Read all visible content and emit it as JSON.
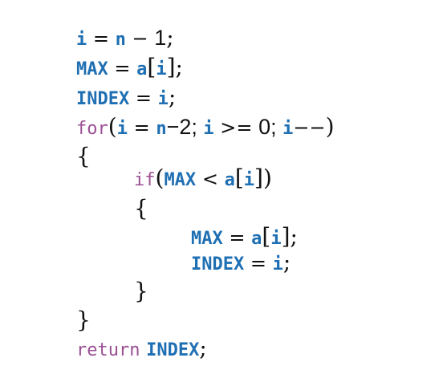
{
  "code": {
    "lines": [
      [
        {
          "text": "i",
          "type": "var"
        },
        {
          "text": " = ",
          "type": "op"
        },
        {
          "text": "n",
          "type": "var"
        },
        {
          "text": " − ",
          "type": "op"
        },
        {
          "text": "1",
          "type": "num"
        },
        {
          "text": ";",
          "type": "punct"
        }
      ],
      [
        {
          "text": "MAX",
          "type": "var"
        },
        {
          "text": " = ",
          "type": "op"
        },
        {
          "text": "a",
          "type": "var"
        },
        {
          "text": "[",
          "type": "punct"
        },
        {
          "text": "i",
          "type": "var"
        },
        {
          "text": "]",
          "type": "punct"
        },
        {
          "text": ";",
          "type": "punct"
        }
      ],
      [
        {
          "text": "INDEX",
          "type": "var"
        },
        {
          "text": " = ",
          "type": "op"
        },
        {
          "text": "i",
          "type": "var"
        },
        {
          "text": ";",
          "type": "punct"
        }
      ],
      [
        {
          "text": "for",
          "type": "kw"
        },
        {
          "text": "(",
          "type": "punct"
        },
        {
          "text": "i",
          "type": "var"
        },
        {
          "text": " = ",
          "type": "op"
        },
        {
          "text": "n",
          "type": "var"
        },
        {
          "text": "−2; ",
          "type": "num"
        },
        {
          "text": "i",
          "type": "var"
        },
        {
          "text": " >= ",
          "type": "op"
        },
        {
          "text": "0; ",
          "type": "num"
        },
        {
          "text": "i",
          "type": "var"
        },
        {
          "text": "−−",
          "type": "op"
        },
        {
          "text": ")",
          "type": "punct"
        }
      ],
      [
        {
          "text": "{",
          "type": "punct"
        }
      ],
      [
        {
          "text": "if",
          "type": "kw"
        },
        {
          "text": "(",
          "type": "punct"
        },
        {
          "text": "MAX",
          "type": "var"
        },
        {
          "text": " < ",
          "type": "op"
        },
        {
          "text": "a",
          "type": "var"
        },
        {
          "text": "[",
          "type": "punct"
        },
        {
          "text": "i",
          "type": "var"
        },
        {
          "text": "]",
          "type": "punct"
        },
        {
          "text": ")",
          "type": "punct"
        }
      ],
      [
        {
          "text": "{",
          "type": "punct"
        }
      ],
      [
        {
          "text": "MAX",
          "type": "var"
        },
        {
          "text": " = ",
          "type": "op"
        },
        {
          "text": "a",
          "type": "var"
        },
        {
          "text": "[",
          "type": "punct"
        },
        {
          "text": "i",
          "type": "var"
        },
        {
          "text": "]",
          "type": "punct"
        },
        {
          "text": ";",
          "type": "punct"
        }
      ],
      [
        {
          "text": "INDEX",
          "type": "var"
        },
        {
          "text": " = ",
          "type": "op"
        },
        {
          "text": "i",
          "type": "var"
        },
        {
          "text": ";",
          "type": "punct"
        }
      ],
      [
        {
          "text": "}",
          "type": "punct"
        }
      ],
      [
        {
          "text": "}",
          "type": "punct"
        }
      ],
      [
        {
          "text": "return",
          "type": "kw"
        },
        {
          "text": " ",
          "type": "op"
        },
        {
          "text": "INDEX",
          "type": "var"
        },
        {
          "text": ";",
          "type": "punct"
        }
      ]
    ]
  },
  "colors": {
    "variable": "#1f6fb3",
    "keyword": "#9a4f93",
    "text": "#111111",
    "background": "#ffffff"
  }
}
